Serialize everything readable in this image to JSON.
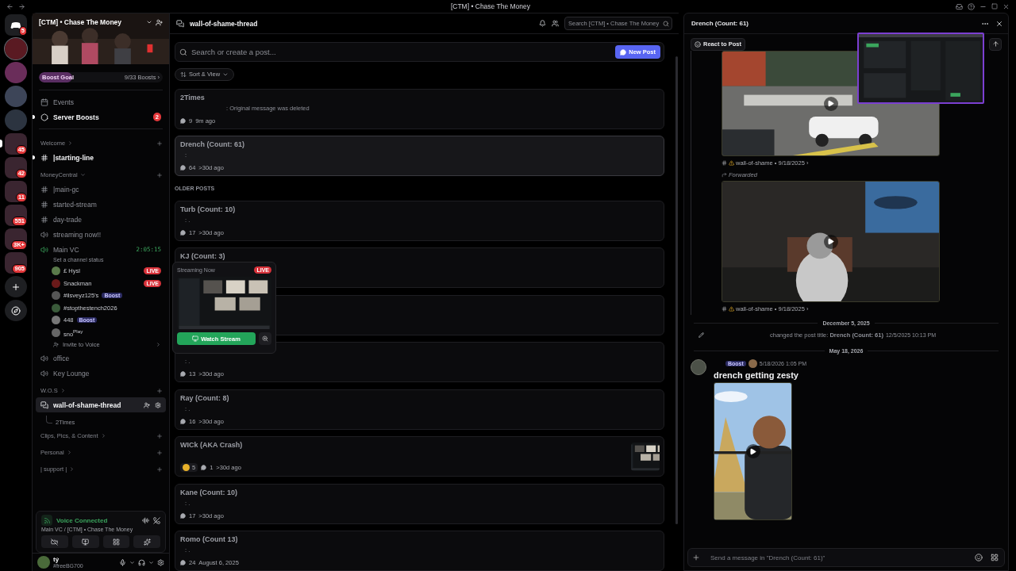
{
  "title_bar": {
    "title": "[CTM] • Chase The Money"
  },
  "servers": [
    {
      "kind": "home",
      "badge": "5"
    },
    {
      "kind": "server",
      "selected": true
    },
    {
      "kind": "server",
      "selected": false
    },
    {
      "kind": "server",
      "selected": false
    },
    {
      "kind": "server",
      "selected": false
    },
    {
      "kind": "folder",
      "badge": "45",
      "selected": false,
      "unread": true
    },
    {
      "kind": "folder",
      "badge": "42",
      "selected": false
    },
    {
      "kind": "folder",
      "badge": "11",
      "selected": false
    },
    {
      "kind": "folder",
      "badge": "551",
      "selected": false
    },
    {
      "kind": "folder",
      "badge": "3K+",
      "selected": false
    },
    {
      "kind": "folder",
      "badge": "905",
      "selected": false
    },
    {
      "kind": "add"
    },
    {
      "kind": "discover"
    }
  ],
  "server": {
    "name": "[CTM] • Chase The Money",
    "boost_goal": {
      "label": "Boost Goal",
      "progress": "9/33 Boosts ›",
      "level": 0.27
    }
  },
  "nav": [
    {
      "kind": "events",
      "label": "Events",
      "unread": false
    },
    {
      "kind": "boosts",
      "label": "Server Boosts",
      "badge": "2",
      "unread": true
    }
  ],
  "categories": [
    {
      "name": "Welcome",
      "expanded": false,
      "channels": [
        {
          "kind": "text",
          "name": "|starting-line",
          "unread": true,
          "selected": false
        }
      ]
    },
    {
      "name": "MoneyCentral",
      "expanded": true,
      "channels": [
        {
          "kind": "text",
          "name": "|main-gc",
          "unread": false,
          "selected": false
        },
        {
          "kind": "text",
          "name": "started-stream",
          "unread": false,
          "selected": false
        },
        {
          "kind": "text",
          "name": "day-trade",
          "unread": false,
          "selected": false
        },
        {
          "kind": "voice",
          "name": "streaming now!!",
          "unread": false,
          "selected": false
        },
        {
          "kind": "voice",
          "name": "Main VC",
          "unread": false,
          "selected": false,
          "connected": true,
          "duration": "2:05:15",
          "status": "Set a channel status",
          "invite": "Invite to Voice",
          "members": [
            {
              "name": "£ Hysl",
              "live": "LIVE"
            },
            {
              "name": "Snackman",
              "live": "LIVE"
            },
            {
              "name": "#ilsveyz125's",
              "boost": "Boost"
            },
            {
              "name": "#stopthestench2026"
            },
            {
              "name": "448",
              "boost": "Boost"
            },
            {
              "name": "sno$^{Play}$"
            }
          ]
        },
        {
          "kind": "voice",
          "name": "office",
          "unread": false,
          "selected": false
        },
        {
          "kind": "voice",
          "name": "Key Lounge",
          "unread": false,
          "selected": false
        }
      ]
    },
    {
      "name": "W.O.S",
      "expanded": false,
      "channels": [
        {
          "kind": "forum",
          "name": "wall-of-shame-thread",
          "selected": true,
          "threads": [
            "2Times"
          ]
        }
      ]
    },
    {
      "name": "Clips, Pics, & Content",
      "expanded": false
    },
    {
      "name": "Personal",
      "expanded": false
    },
    {
      "name": "| support |",
      "expanded": false
    }
  ],
  "voice_panel": {
    "status": "Voice Connected",
    "location": "Main VC / [CTM] • Chase The Money"
  },
  "user": {
    "name": "tý",
    "tag": "#freeBG700"
  },
  "channel_header": {
    "name": "wall-of-shame-thread",
    "search_placeholder": "Search [CTM] • Chase The Money"
  },
  "forum": {
    "search_placeholder": "Search or create a post...",
    "new_post": "New Post",
    "sort": "Sort & View",
    "posts": [
      {
        "title": "2Times",
        "preview": ": Original message was deleted",
        "replies": "9",
        "time": "9m ago",
        "selected": false
      },
      {
        "title": "Drench (Count: 61)",
        "preview": ":",
        "replies": "64",
        "time": ">30d ago",
        "selected": true
      }
    ],
    "older_heading": "OLDER POSTS",
    "older_posts": [
      {
        "title": "Turb (Count: 10)",
        "preview": ": .",
        "replies": "17",
        "time": ">30d ago",
        "selected": false
      },
      {
        "title": "KJ (Count: 3)",
        "selected": false
      },
      {
        "selected": false
      },
      {
        "preview": ": .",
        "replies": "13",
        "time": ">30d ago",
        "selected": false
      },
      {
        "title": "Ray (Count: 8)",
        "preview": ": .",
        "replies": "16",
        "time": ">30d ago",
        "selected": false
      },
      {
        "title": "WICk (AKA Crash)",
        "reactions": "5",
        "replies": "1",
        "time": ">30d ago",
        "thumbnail": true,
        "selected": false
      },
      {
        "title": "Kane (Count: 10)",
        "preview": ": .",
        "replies": "17",
        "time": ">30d ago",
        "selected": false
      },
      {
        "title": "Romo (Count 13)",
        "preview": ": .",
        "replies": "24",
        "time": "August 6, 2025",
        "selected": false
      }
    ]
  },
  "stream_popup": {
    "label": "Streaming Now",
    "live": "LIVE",
    "watch": "Watch Stream"
  },
  "thread": {
    "title": "Drench (Count: 61)",
    "react": "React to Post",
    "items": [
      {
        "kind": "video"
      },
      {
        "kind": "caption",
        "text": "wall-of-shame • 9/18/2025 ›"
      },
      {
        "kind": "forwarded",
        "label": "Forwarded"
      },
      {
        "kind": "video"
      },
      {
        "kind": "caption",
        "text": "wall-of-shame • 9/18/2025 ›"
      },
      {
        "kind": "divider",
        "label": "December 5, 2025"
      },
      {
        "kind": "system",
        "text": "changed the post title: **Drench (Count: 61)**",
        "time": "12/5/2025 10:13 PM"
      },
      {
        "kind": "divider",
        "label": "May 18, 2026"
      },
      {
        "kind": "message",
        "badge": "Boost",
        "time": "5/18/2026 1:05 PM",
        "text": "**drench getting zesty**"
      }
    ],
    "input_placeholder": "Send a message in \"Drench (Count: 61)\""
  }
}
